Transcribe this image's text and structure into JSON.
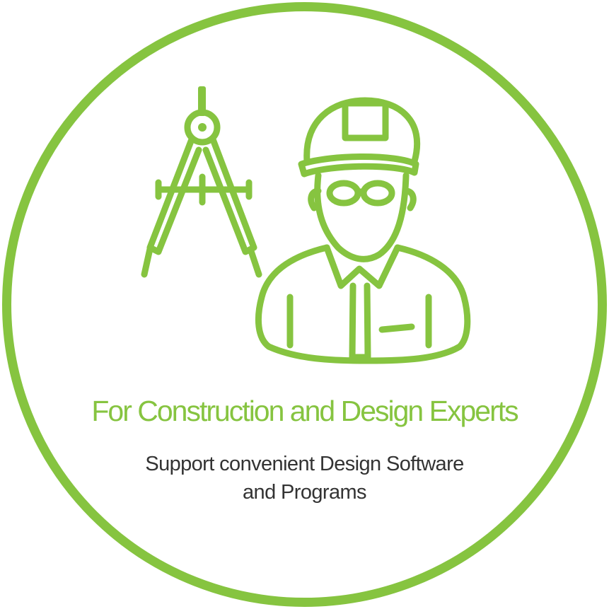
{
  "colors": {
    "accent": "#86c440",
    "text": "#333333",
    "background": "#ffffff"
  },
  "icons": {
    "compass": "drafting-compass-icon",
    "engineer": "engineer-hard-hat-icon"
  },
  "headline": "For Construction and Design Experts",
  "description": {
    "line1": "Support convenient Design Software",
    "line2": "and Programs"
  }
}
